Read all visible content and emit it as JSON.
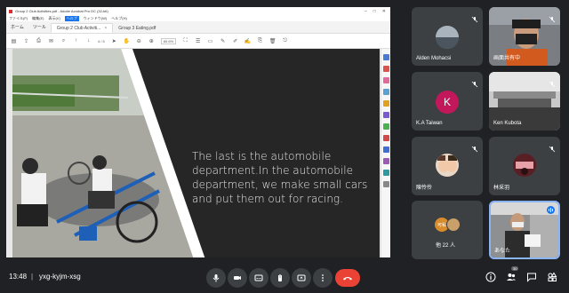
{
  "acrobat": {
    "window_title": "Group 2 Club Activities.pdf - Adobe Acrobat Pro DC (32-bit)",
    "menu": [
      "ファイル(F)",
      "編集(E)",
      "表示(V)"
    ],
    "menu_help": "ヘルプ",
    "menu_extra": [
      "ウィンドウ(W)",
      "ヘルプ(H)"
    ],
    "home_label": "ホーム",
    "tools_label": "ツール",
    "tabs": [
      {
        "label": "Group 2 Club Activiti...",
        "active": true
      },
      {
        "label": "Group 3 Eating.pdf",
        "active": false
      }
    ],
    "page_info": "4 / 5",
    "zoom": "80.6%"
  },
  "slide": {
    "text": "The last is the automobile department.In the automobile department, we make small cars and put them out for racing."
  },
  "participants": [
    {
      "name": "Alden Mohacsi",
      "muted": true,
      "avatar_color": "#6d7a83"
    },
    {
      "name": "画面共有中",
      "muted": true,
      "avatar_color": null
    },
    {
      "name": "K.A Taiwan",
      "muted": true,
      "avatar_letter": "K",
      "avatar_color": "#c2185b"
    },
    {
      "name": "Ken Kubota",
      "muted": true,
      "avatar_color": null
    },
    {
      "name": "陳怜伶",
      "muted": true,
      "avatar_color": "#8a6d5a"
    },
    {
      "name": "林采羽",
      "muted": true,
      "avatar_color": "#6b2b2b"
    },
    {
      "name": "他 22 人",
      "muted": false,
      "avatar_color": "#d98c2c"
    },
    {
      "name": "あなた",
      "muted": false,
      "avatar_color": null
    }
  ],
  "others_badge_text": "可私",
  "meeting": {
    "time": "13:48",
    "separator": "|",
    "code": "yxg-kyjm-xsg",
    "participant_count": "30"
  },
  "colors": {
    "background": "#202124",
    "tile": "#3c4043",
    "end_call": "#ea4335",
    "accent": "#8ab4f8"
  }
}
